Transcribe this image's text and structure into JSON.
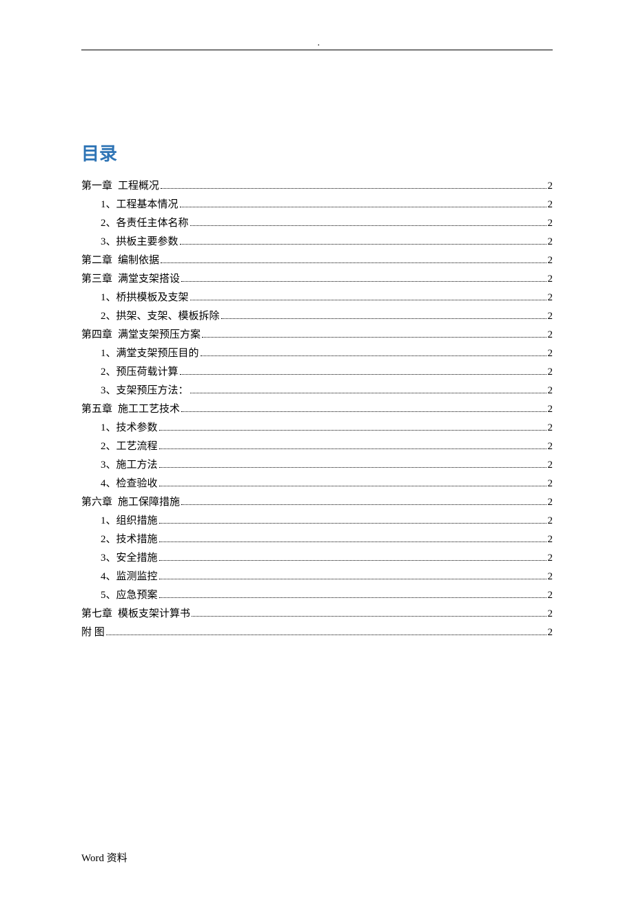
{
  "title": "目录",
  "footer": "Word  资料",
  "toc": [
    {
      "level": 1,
      "label": "第一章",
      "text": "工程概况",
      "page": "2"
    },
    {
      "level": 2,
      "label": "1、",
      "text": "工程基本情况",
      "page": "2"
    },
    {
      "level": 2,
      "label": "2、",
      "text": "各责任主体名称",
      "page": "2"
    },
    {
      "level": 2,
      "label": "3、",
      "text": "拱板主要参数",
      "page": "2"
    },
    {
      "level": 1,
      "label": "第二章",
      "text": "编制依据",
      "page": "2"
    },
    {
      "level": 1,
      "label": "第三章",
      "text": "满堂支架搭设",
      "page": "2"
    },
    {
      "level": 2,
      "label": "1、",
      "text": "桥拱模板及支架",
      "page": "2"
    },
    {
      "level": 2,
      "label": "2、",
      "text": "拱架、支架、模板拆除",
      "page": "2"
    },
    {
      "level": 1,
      "label": "第四章",
      "text": "满堂支架预压方案",
      "page": "2"
    },
    {
      "level": 2,
      "label": "1、",
      "text": "满堂支架预压目的",
      "page": "2"
    },
    {
      "level": 2,
      "label": "2、",
      "text": "预压荷载计算",
      "page": "2"
    },
    {
      "level": 2,
      "label": "3、",
      "text": "支架预压方法：",
      "page": "2"
    },
    {
      "level": 1,
      "label": "第五章",
      "text": "施工工艺技术",
      "page": "2"
    },
    {
      "level": 2,
      "label": "1、",
      "text": "技术参数",
      "page": "2"
    },
    {
      "level": 2,
      "label": "2、",
      "text": "工艺流程",
      "page": "2"
    },
    {
      "level": 2,
      "label": "3、",
      "text": "施工方法",
      "page": "2"
    },
    {
      "level": 2,
      "label": "4、",
      "text": "检查验收",
      "page": "2"
    },
    {
      "level": 1,
      "label": "第六章",
      "text": "施工保障措施",
      "page": "2"
    },
    {
      "level": 2,
      "label": "1、",
      "text": "组织措施",
      "page": "2"
    },
    {
      "level": 2,
      "label": "2、",
      "text": "技术措施",
      "page": "2"
    },
    {
      "level": 2,
      "label": "3、",
      "text": "安全措施",
      "page": "2"
    },
    {
      "level": 2,
      "label": "4、",
      "text": "监测监控",
      "page": "2"
    },
    {
      "level": 2,
      "label": "5、",
      "text": "应急预案",
      "page": "2"
    },
    {
      "level": 1,
      "label": "第七章",
      "text": "模板支架计算书",
      "page": "2"
    },
    {
      "level": 1,
      "label": "附  图",
      "text": "",
      "page": "2"
    }
  ]
}
